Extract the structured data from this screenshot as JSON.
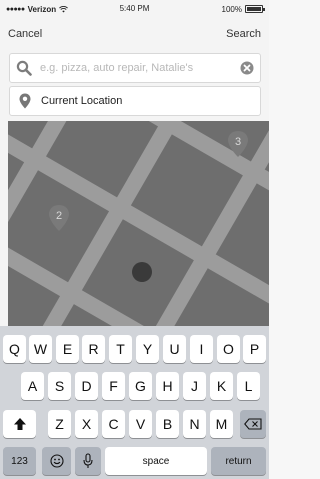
{
  "status_bar": {
    "signal": "●●●●●",
    "carrier": "Verizon",
    "wifi_icon": "wifi-icon",
    "time": "5:40 PM",
    "battery": "100%",
    "battery_icon": "battery-icon"
  },
  "nav": {
    "cancel_label": "Cancel",
    "search_label": "Search"
  },
  "search": {
    "placeholder": "e.g. pizza, auto repair, Natalie's",
    "value": "",
    "icon": "search-icon",
    "clear_icon": "clear-icon"
  },
  "location": {
    "icon": "map-pin-icon",
    "label": "Current Location"
  },
  "map": {
    "markers": [
      {
        "label": "3",
        "icon": "map-marker-icon"
      },
      {
        "label": "2",
        "icon": "map-marker-icon"
      }
    ],
    "current_location_icon": "current-location-dot",
    "colors": {
      "block": "#6e6e6e",
      "road": "#9c9c9c",
      "marker": "#7a7a7a",
      "dot": "#3a3a3a"
    }
  },
  "keyboard": {
    "row1": [
      "Q",
      "W",
      "E",
      "R",
      "T",
      "Y",
      "U",
      "I",
      "O",
      "P"
    ],
    "row2": [
      "A",
      "S",
      "D",
      "F",
      "G",
      "H",
      "J",
      "K",
      "L"
    ],
    "row3": [
      "Z",
      "X",
      "C",
      "V",
      "B",
      "N",
      "M"
    ],
    "shift_icon": "shift-icon",
    "delete_icon": "backspace-icon",
    "numbers_label": "123",
    "emoji_icon": "emoji-icon",
    "mic_icon": "microphone-icon",
    "space_label": "space",
    "return_label": "return"
  }
}
